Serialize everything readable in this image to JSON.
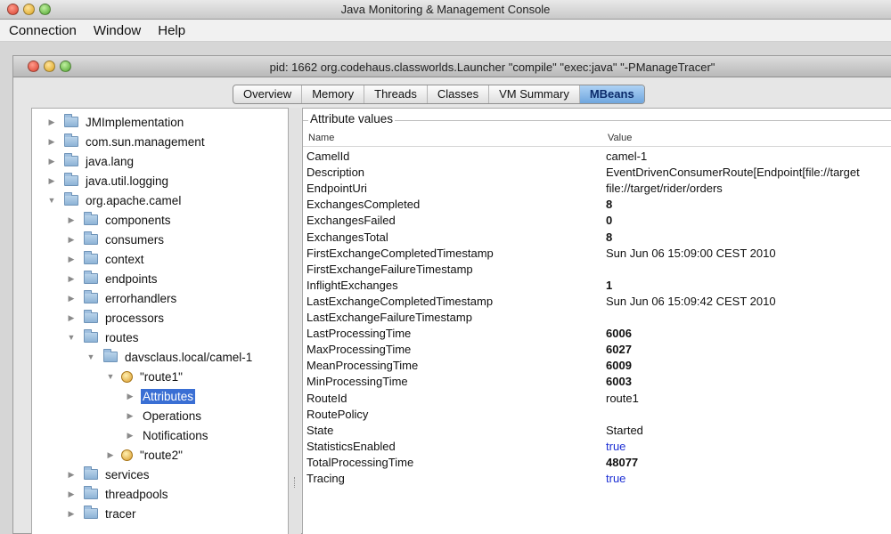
{
  "window": {
    "title": "Java Monitoring & Management Console"
  },
  "menubar": {
    "items": [
      "Connection",
      "Window",
      "Help"
    ]
  },
  "inner_window": {
    "title": "pid: 1662 org.codehaus.classworlds.Launcher \"compile\" \"exec:java\" \"-PManageTracer\""
  },
  "tabs": [
    {
      "label": "Overview",
      "active": false
    },
    {
      "label": "Memory",
      "active": false
    },
    {
      "label": "Threads",
      "active": false
    },
    {
      "label": "Classes",
      "active": false
    },
    {
      "label": "VM Summary",
      "active": false
    },
    {
      "label": "MBeans",
      "active": true
    }
  ],
  "tree": [
    {
      "label": "JMImplementation",
      "icon": "folder-icon",
      "expanded": false,
      "depth": 0,
      "has_arrow": true
    },
    {
      "label": "com.sun.management",
      "icon": "folder-icon",
      "expanded": false,
      "depth": 0,
      "has_arrow": true
    },
    {
      "label": "java.lang",
      "icon": "folder-icon",
      "expanded": false,
      "depth": 0,
      "has_arrow": true
    },
    {
      "label": "java.util.logging",
      "icon": "folder-icon",
      "expanded": false,
      "depth": 0,
      "has_arrow": true
    },
    {
      "label": "org.apache.camel",
      "icon": "folder-icon",
      "expanded": true,
      "depth": 0,
      "has_arrow": true
    },
    {
      "label": "components",
      "icon": "folder-icon",
      "expanded": false,
      "depth": 1,
      "has_arrow": true
    },
    {
      "label": "consumers",
      "icon": "folder-icon",
      "expanded": false,
      "depth": 1,
      "has_arrow": true
    },
    {
      "label": "context",
      "icon": "folder-icon",
      "expanded": false,
      "depth": 1,
      "has_arrow": true
    },
    {
      "label": "endpoints",
      "icon": "folder-icon",
      "expanded": false,
      "depth": 1,
      "has_arrow": true
    },
    {
      "label": "errorhandlers",
      "icon": "folder-icon",
      "expanded": false,
      "depth": 1,
      "has_arrow": true
    },
    {
      "label": "processors",
      "icon": "folder-icon",
      "expanded": false,
      "depth": 1,
      "has_arrow": true
    },
    {
      "label": "routes",
      "icon": "folder-icon",
      "expanded": true,
      "depth": 1,
      "has_arrow": true
    },
    {
      "label": "davsclaus.local/camel-1",
      "icon": "folder-icon",
      "expanded": true,
      "depth": 2,
      "has_arrow": true
    },
    {
      "label": "\"route1\"",
      "icon": "bean-icon",
      "expanded": true,
      "depth": 3,
      "has_arrow": true
    },
    {
      "label": "Attributes",
      "icon": "",
      "expanded": false,
      "depth": 4,
      "has_arrow": true,
      "selected": true
    },
    {
      "label": "Operations",
      "icon": "",
      "expanded": false,
      "depth": 4,
      "has_arrow": true
    },
    {
      "label": "Notifications",
      "icon": "",
      "expanded": false,
      "depth": 4,
      "has_arrow": true
    },
    {
      "label": "\"route2\"",
      "icon": "bean-icon",
      "expanded": false,
      "depth": 3,
      "has_arrow": true
    },
    {
      "label": "services",
      "icon": "folder-icon",
      "expanded": false,
      "depth": 1,
      "has_arrow": true
    },
    {
      "label": "threadpools",
      "icon": "folder-icon",
      "expanded": false,
      "depth": 1,
      "has_arrow": true
    },
    {
      "label": "tracer",
      "icon": "folder-icon",
      "expanded": false,
      "depth": 1,
      "has_arrow": true
    }
  ],
  "attributes": {
    "title": "Attribute values",
    "columns": {
      "name": "Name",
      "value": "Value"
    },
    "rows": [
      {
        "name": "CamelId",
        "value": "camel-1",
        "kind": "text"
      },
      {
        "name": "Description",
        "value": "EventDrivenConsumerRoute[Endpoint[file://target",
        "kind": "text"
      },
      {
        "name": "EndpointUri",
        "value": "file://target/rider/orders",
        "kind": "text"
      },
      {
        "name": "ExchangesCompleted",
        "value": "8",
        "kind": "num"
      },
      {
        "name": "ExchangesFailed",
        "value": "0",
        "kind": "num"
      },
      {
        "name": "ExchangesTotal",
        "value": "8",
        "kind": "num"
      },
      {
        "name": "FirstExchangeCompletedTimestamp",
        "value": "Sun Jun 06 15:09:00 CEST 2010",
        "kind": "text"
      },
      {
        "name": "FirstExchangeFailureTimestamp",
        "value": "",
        "kind": "text"
      },
      {
        "name": "InflightExchanges",
        "value": "1",
        "kind": "num"
      },
      {
        "name": "LastExchangeCompletedTimestamp",
        "value": "Sun Jun 06 15:09:42 CEST 2010",
        "kind": "text"
      },
      {
        "name": "LastExchangeFailureTimestamp",
        "value": "",
        "kind": "text"
      },
      {
        "name": "LastProcessingTime",
        "value": "6006",
        "kind": "num"
      },
      {
        "name": "MaxProcessingTime",
        "value": "6027",
        "kind": "num"
      },
      {
        "name": "MeanProcessingTime",
        "value": "6009",
        "kind": "num"
      },
      {
        "name": "MinProcessingTime",
        "value": "6003",
        "kind": "num"
      },
      {
        "name": "RouteId",
        "value": "route1",
        "kind": "text"
      },
      {
        "name": "RoutePolicy",
        "value": "",
        "kind": "text"
      },
      {
        "name": "State",
        "value": "Started",
        "kind": "text"
      },
      {
        "name": "StatisticsEnabled",
        "value": "true",
        "kind": "bool"
      },
      {
        "name": "TotalProcessingTime",
        "value": "48077",
        "kind": "num"
      },
      {
        "name": "Tracing",
        "value": "true",
        "kind": "bool"
      }
    ]
  },
  "colors": {
    "selection": "#3a6fd4",
    "boolean_value": "#1c2fd4",
    "active_tab": "#6fa6de"
  }
}
